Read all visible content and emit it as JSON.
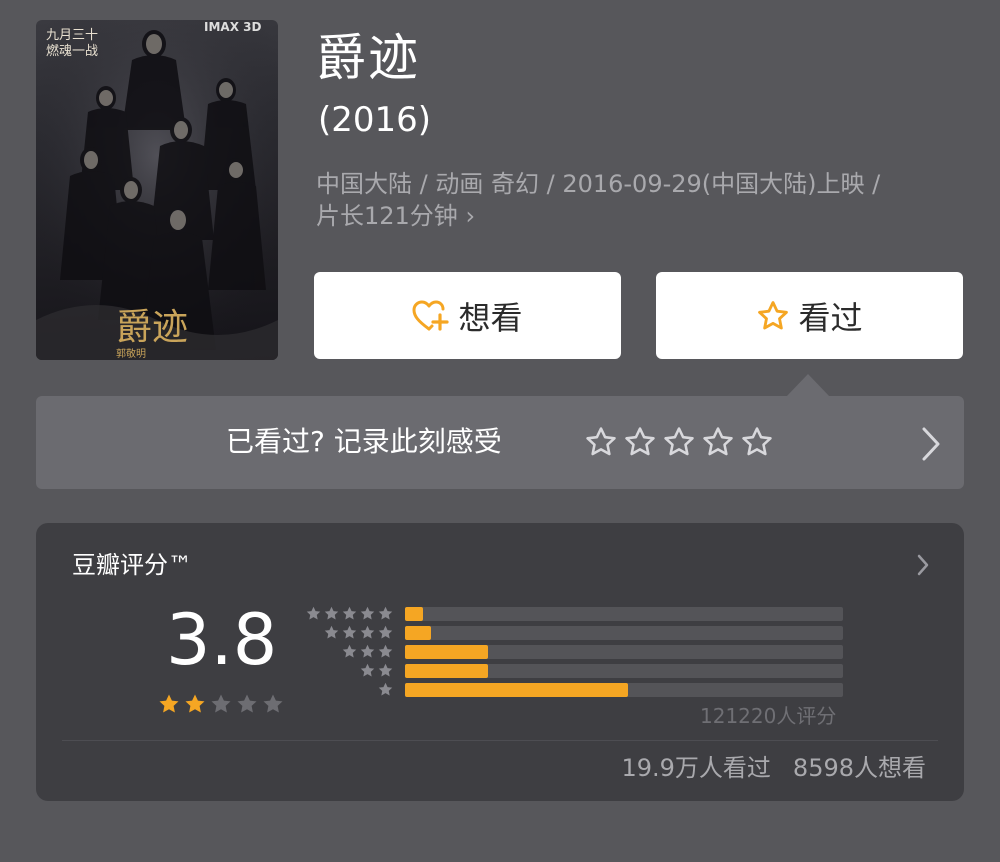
{
  "poster": {
    "top_text": "九月三十\n燃魂一战",
    "imax_label": "IMAX 3D",
    "title_art": "爵迹",
    "credit": "郭敬明"
  },
  "movie": {
    "title": "爵迹",
    "year": "(2016)",
    "meta_line1": "中国大陆 / 动画 奇幻 / 2016-09-29(中国大陆)上映 /",
    "meta_line2": "片长121分钟",
    "meta_chevron": "›"
  },
  "actions": {
    "want_label": "想看",
    "seen_label": "看过",
    "icon_color": "#f5a623"
  },
  "rate_prompt": {
    "text": "已看过? 记录此刻感受",
    "star_count": 5
  },
  "rating": {
    "label": "豆瓣评分™",
    "score": "3.8",
    "score_stars_filled": 2,
    "score_stars_total": 5,
    "distribution": [
      {
        "stars": 5,
        "fraction": 0.04
      },
      {
        "stars": 4,
        "fraction": 0.06
      },
      {
        "stars": 3,
        "fraction": 0.19
      },
      {
        "stars": 2,
        "fraction": 0.19
      },
      {
        "stars": 1,
        "fraction": 0.51
      }
    ],
    "count_text": "121220人评分",
    "bar_color": "#f5a623"
  },
  "stats": {
    "seen_text": "19.9万人看过",
    "want_text": "8598人想看"
  }
}
